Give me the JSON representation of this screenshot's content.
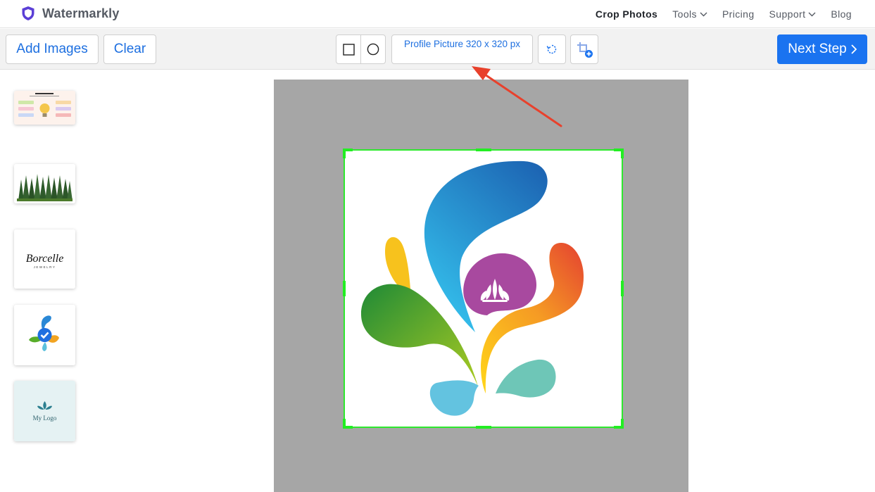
{
  "app": {
    "name": "Watermarkly",
    "brand_color": "#5b3fd6"
  },
  "nav": {
    "items": [
      {
        "label": "Crop Photos",
        "active": true
      },
      {
        "label": "Tools",
        "has_dropdown": true
      },
      {
        "label": "Pricing"
      },
      {
        "label": "Support",
        "has_dropdown": true
      },
      {
        "label": "Blog"
      }
    ]
  },
  "toolbar": {
    "add_images_label": "Add Images",
    "clear_label": "Clear",
    "shape_rect_icon": "square-icon",
    "shape_circle_icon": "circle-icon",
    "size_preset_label": "Profile Picture 320 x 320 px",
    "rotate_icon": "rotate-icon",
    "add_crop_icon": "add-crop-icon",
    "next_step_label": "Next Step",
    "accent_color": "#1a73f0"
  },
  "sidebar": {
    "thumbnails": [
      {
        "name": "infographic-thumbnail"
      },
      {
        "name": "forest-thumbnail"
      },
      {
        "name": "borcelle-logo-thumbnail",
        "text": "Borcelle",
        "subtext": "JEWELRY"
      },
      {
        "name": "splash-logo-thumbnail",
        "selected": true
      },
      {
        "name": "my-logo-thumbnail",
        "text": "My Logo"
      }
    ]
  },
  "canvas": {
    "background": "#a6a6a6",
    "crop_border_color": "#2ee82e"
  },
  "annotation": {
    "arrow_color": "#e8412c"
  }
}
